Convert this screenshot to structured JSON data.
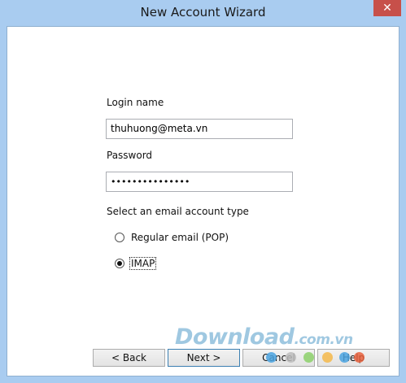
{
  "window": {
    "title": "New Account Wizard",
    "close_symbol": "✕"
  },
  "form": {
    "login_label": "Login name",
    "login_value": "thuhuong@meta.vn",
    "password_label": "Password",
    "password_value": "•••••••••••••••",
    "account_type_label": "Select an email account type",
    "options": [
      {
        "label": "Regular email (POP)",
        "checked": false
      },
      {
        "label": "IMAP",
        "checked": true
      }
    ]
  },
  "buttons": {
    "back": "< Back",
    "next": "Next >",
    "cancel": "Cancel",
    "help": "Help"
  },
  "watermark": {
    "brand": "Download",
    "tld": ".com.vn"
  },
  "colors": {
    "titlebar": "#a9ccf0",
    "close_button": "#c7504a",
    "watermark": "#8fbfdc"
  }
}
